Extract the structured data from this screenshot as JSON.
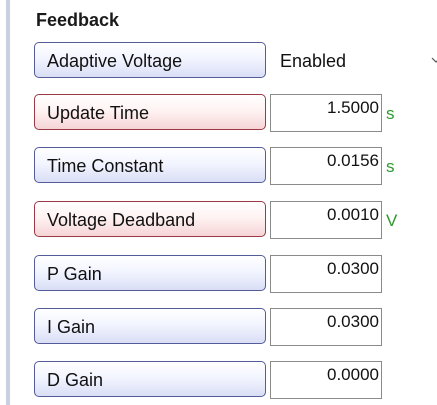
{
  "panel": {
    "title": "Feedback"
  },
  "rows": [
    {
      "label": "Adaptive Voltage",
      "type": "select",
      "value": "Enabled",
      "style": "blue"
    },
    {
      "label": "Update Time",
      "type": "number",
      "value": "1.5000",
      "unit": "s",
      "style": "red"
    },
    {
      "label": "Time Constant",
      "type": "number",
      "value": "0.0156",
      "unit": "s",
      "style": "blue"
    },
    {
      "label": "Voltage Deadband",
      "type": "number",
      "value": "0.0010",
      "unit": "V",
      "style": "red"
    },
    {
      "label": "P Gain",
      "type": "number",
      "value": "0.0300",
      "unit": "",
      "style": "blue"
    },
    {
      "label": "I Gain",
      "type": "number",
      "value": "0.0300",
      "unit": "",
      "style": "blue"
    },
    {
      "label": "D Gain",
      "type": "number",
      "value": "0.0000",
      "unit": "",
      "style": "blue"
    }
  ],
  "icons": {
    "select_chevron": "chevron-down-icon"
  },
  "colors": {
    "label_blue_border": "#545c9a",
    "label_red_border": "#9a3a45",
    "unit_text": "#2e9a2e"
  }
}
